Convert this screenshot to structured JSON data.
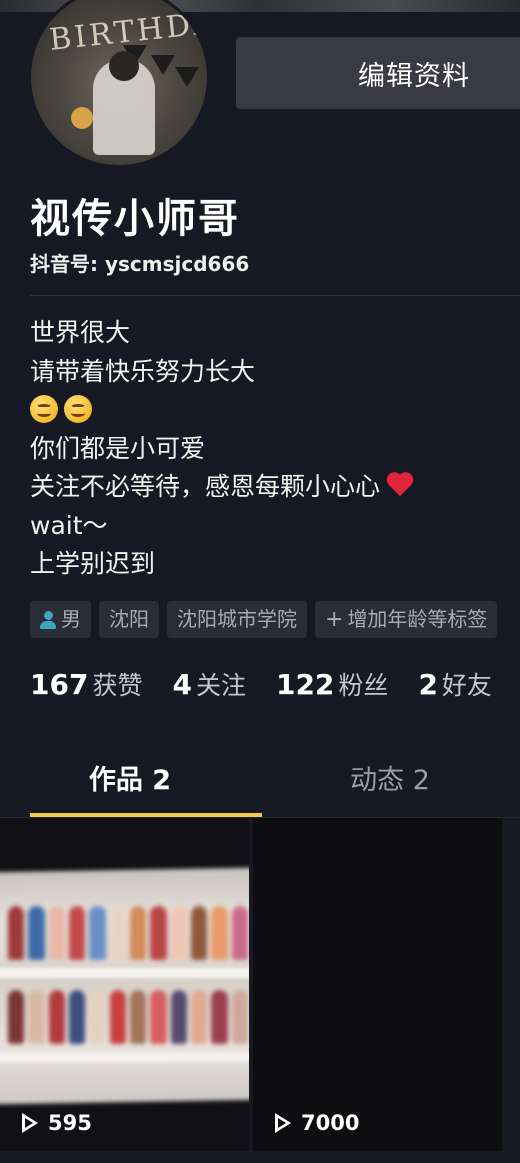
{
  "profile": {
    "name": "视传小师哥",
    "douyin_id": "抖音号: yscmsjcd666",
    "edit_button_label": "编辑资料",
    "avatar_banner_text": "BIRTHDAY"
  },
  "bio": {
    "lines": [
      "世界很大",
      "请带着快乐努力长大",
      "",
      "你们都是小可爱",
      "关注不必等待，感恩每颗小心心",
      "wait～",
      "上学别迟到"
    ],
    "emoji_line_icons": [
      "smiling-face-icon",
      "smiling-face-icon"
    ],
    "heart_icon": "red-heart-icon"
  },
  "tags": [
    {
      "label": "男",
      "icon": "person-icon"
    },
    {
      "label": "沈阳"
    },
    {
      "label": "沈阳城市学院"
    },
    {
      "label": "增加年龄等标签",
      "icon": "plus-icon"
    }
  ],
  "stats": [
    {
      "value": "167",
      "label": "获赞"
    },
    {
      "value": "4",
      "label": "关注"
    },
    {
      "value": "122",
      "label": "粉丝"
    },
    {
      "value": "2",
      "label": "好友"
    }
  ],
  "tabs": {
    "works": "作品 2",
    "dynamics": "动态 2",
    "active": "works"
  },
  "videos": [
    {
      "plays": "595",
      "icon": "play-icon"
    },
    {
      "plays": "7000",
      "icon": "play-icon"
    }
  ],
  "colors": {
    "background": "#161823",
    "tab_underline": "#f2c94c",
    "tag_background": "#2a2c36",
    "heart": "#e0263c"
  }
}
